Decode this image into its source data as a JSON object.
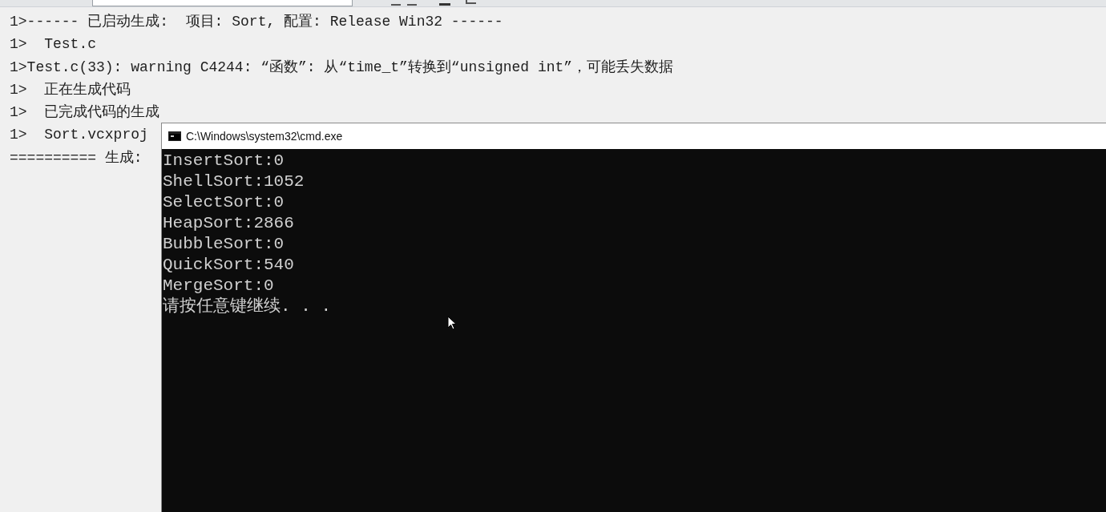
{
  "output": {
    "lines": [
      "1>------ 已启动生成:  项目: Sort, 配置: Release Win32 ------",
      "1>  Test.c",
      "1>Test.c(33): warning C4244: “函数”: 从“time_t”转换到“unsigned int”，可能丢失数据",
      "1>  正在生成代码",
      "1>  已完成代码的生成",
      "1>  Sort.vcxproj",
      "========== 生成:"
    ]
  },
  "console": {
    "title": "C:\\Windows\\system32\\cmd.exe",
    "lines": [
      "InsertSort:0",
      "ShellSort:1052",
      "SelectSort:0",
      "HeapSort:2866",
      "BubbleSort:0",
      "QuickSort:540",
      "MergeSort:0",
      "请按任意键继续. . ."
    ]
  }
}
